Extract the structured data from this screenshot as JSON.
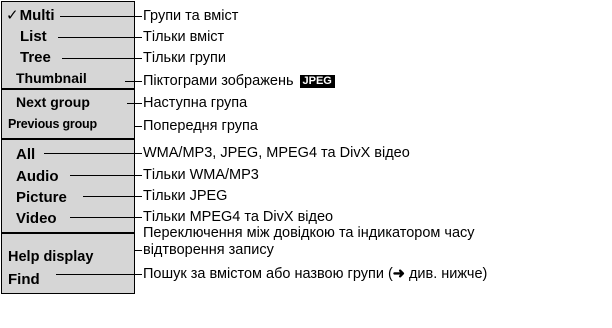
{
  "menu": {
    "group_playback_mode": [
      {
        "label": "Multi",
        "checked": true,
        "desc": "Групи та вміст"
      },
      {
        "label": "List",
        "desc": "Тільки вміст"
      },
      {
        "label": "Tree",
        "desc": "Тільки групи"
      },
      {
        "label": "Thumbnail",
        "desc": "Піктограми зображень",
        "badge": "JPEG"
      }
    ],
    "group_navigation": [
      {
        "label": "Next group",
        "desc": "Наступна група"
      },
      {
        "label": "Previous group",
        "desc": "Попередня група"
      }
    ],
    "group_filter": [
      {
        "label": "All",
        "desc": "WMA/MP3, JPEG, MPEG4 та DivX відео"
      },
      {
        "label": "Audio",
        "desc": "Тільки WMA/MP3"
      },
      {
        "label": "Picture",
        "desc": "Тільки JPEG"
      },
      {
        "label": "Video",
        "desc": "Тільки MPEG4 та DivX відео"
      }
    ],
    "group_tools": [
      {
        "label": "Help display",
        "desc_line1": "Переключення між довідкою та індикатором часу",
        "desc_line2": "відтворення запису"
      },
      {
        "label": "Find",
        "desc_pre": "Пошук за вмістом або назвою групи (",
        "arrow": "➜",
        "desc_post": " див. нижче)"
      }
    ]
  },
  "check_glyph": "✓"
}
